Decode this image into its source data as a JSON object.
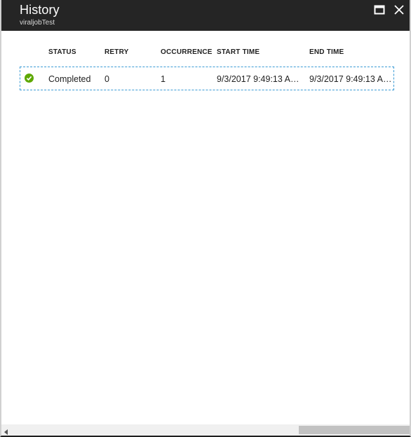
{
  "window": {
    "title": "History",
    "subtitle": "viraljobTest",
    "maximize_icon": "maximize-icon",
    "close_icon": "close-icon"
  },
  "grid": {
    "columns": [
      "STATUS",
      "RETRY",
      "OCCURRENCE",
      "START TIME",
      "END TIME"
    ],
    "rows": [
      {
        "status_icon": "check-circle-icon",
        "status": "Completed",
        "retry": "0",
        "occurrence": "1",
        "start_time": "9/3/2017 9:49:13 AM...",
        "end_time": "9/3/2017 9:49:13 AM..."
      }
    ]
  },
  "colors": {
    "header_bg": "#252525",
    "success_green": "#5ea800",
    "selection_border": "#3a9bd5"
  }
}
